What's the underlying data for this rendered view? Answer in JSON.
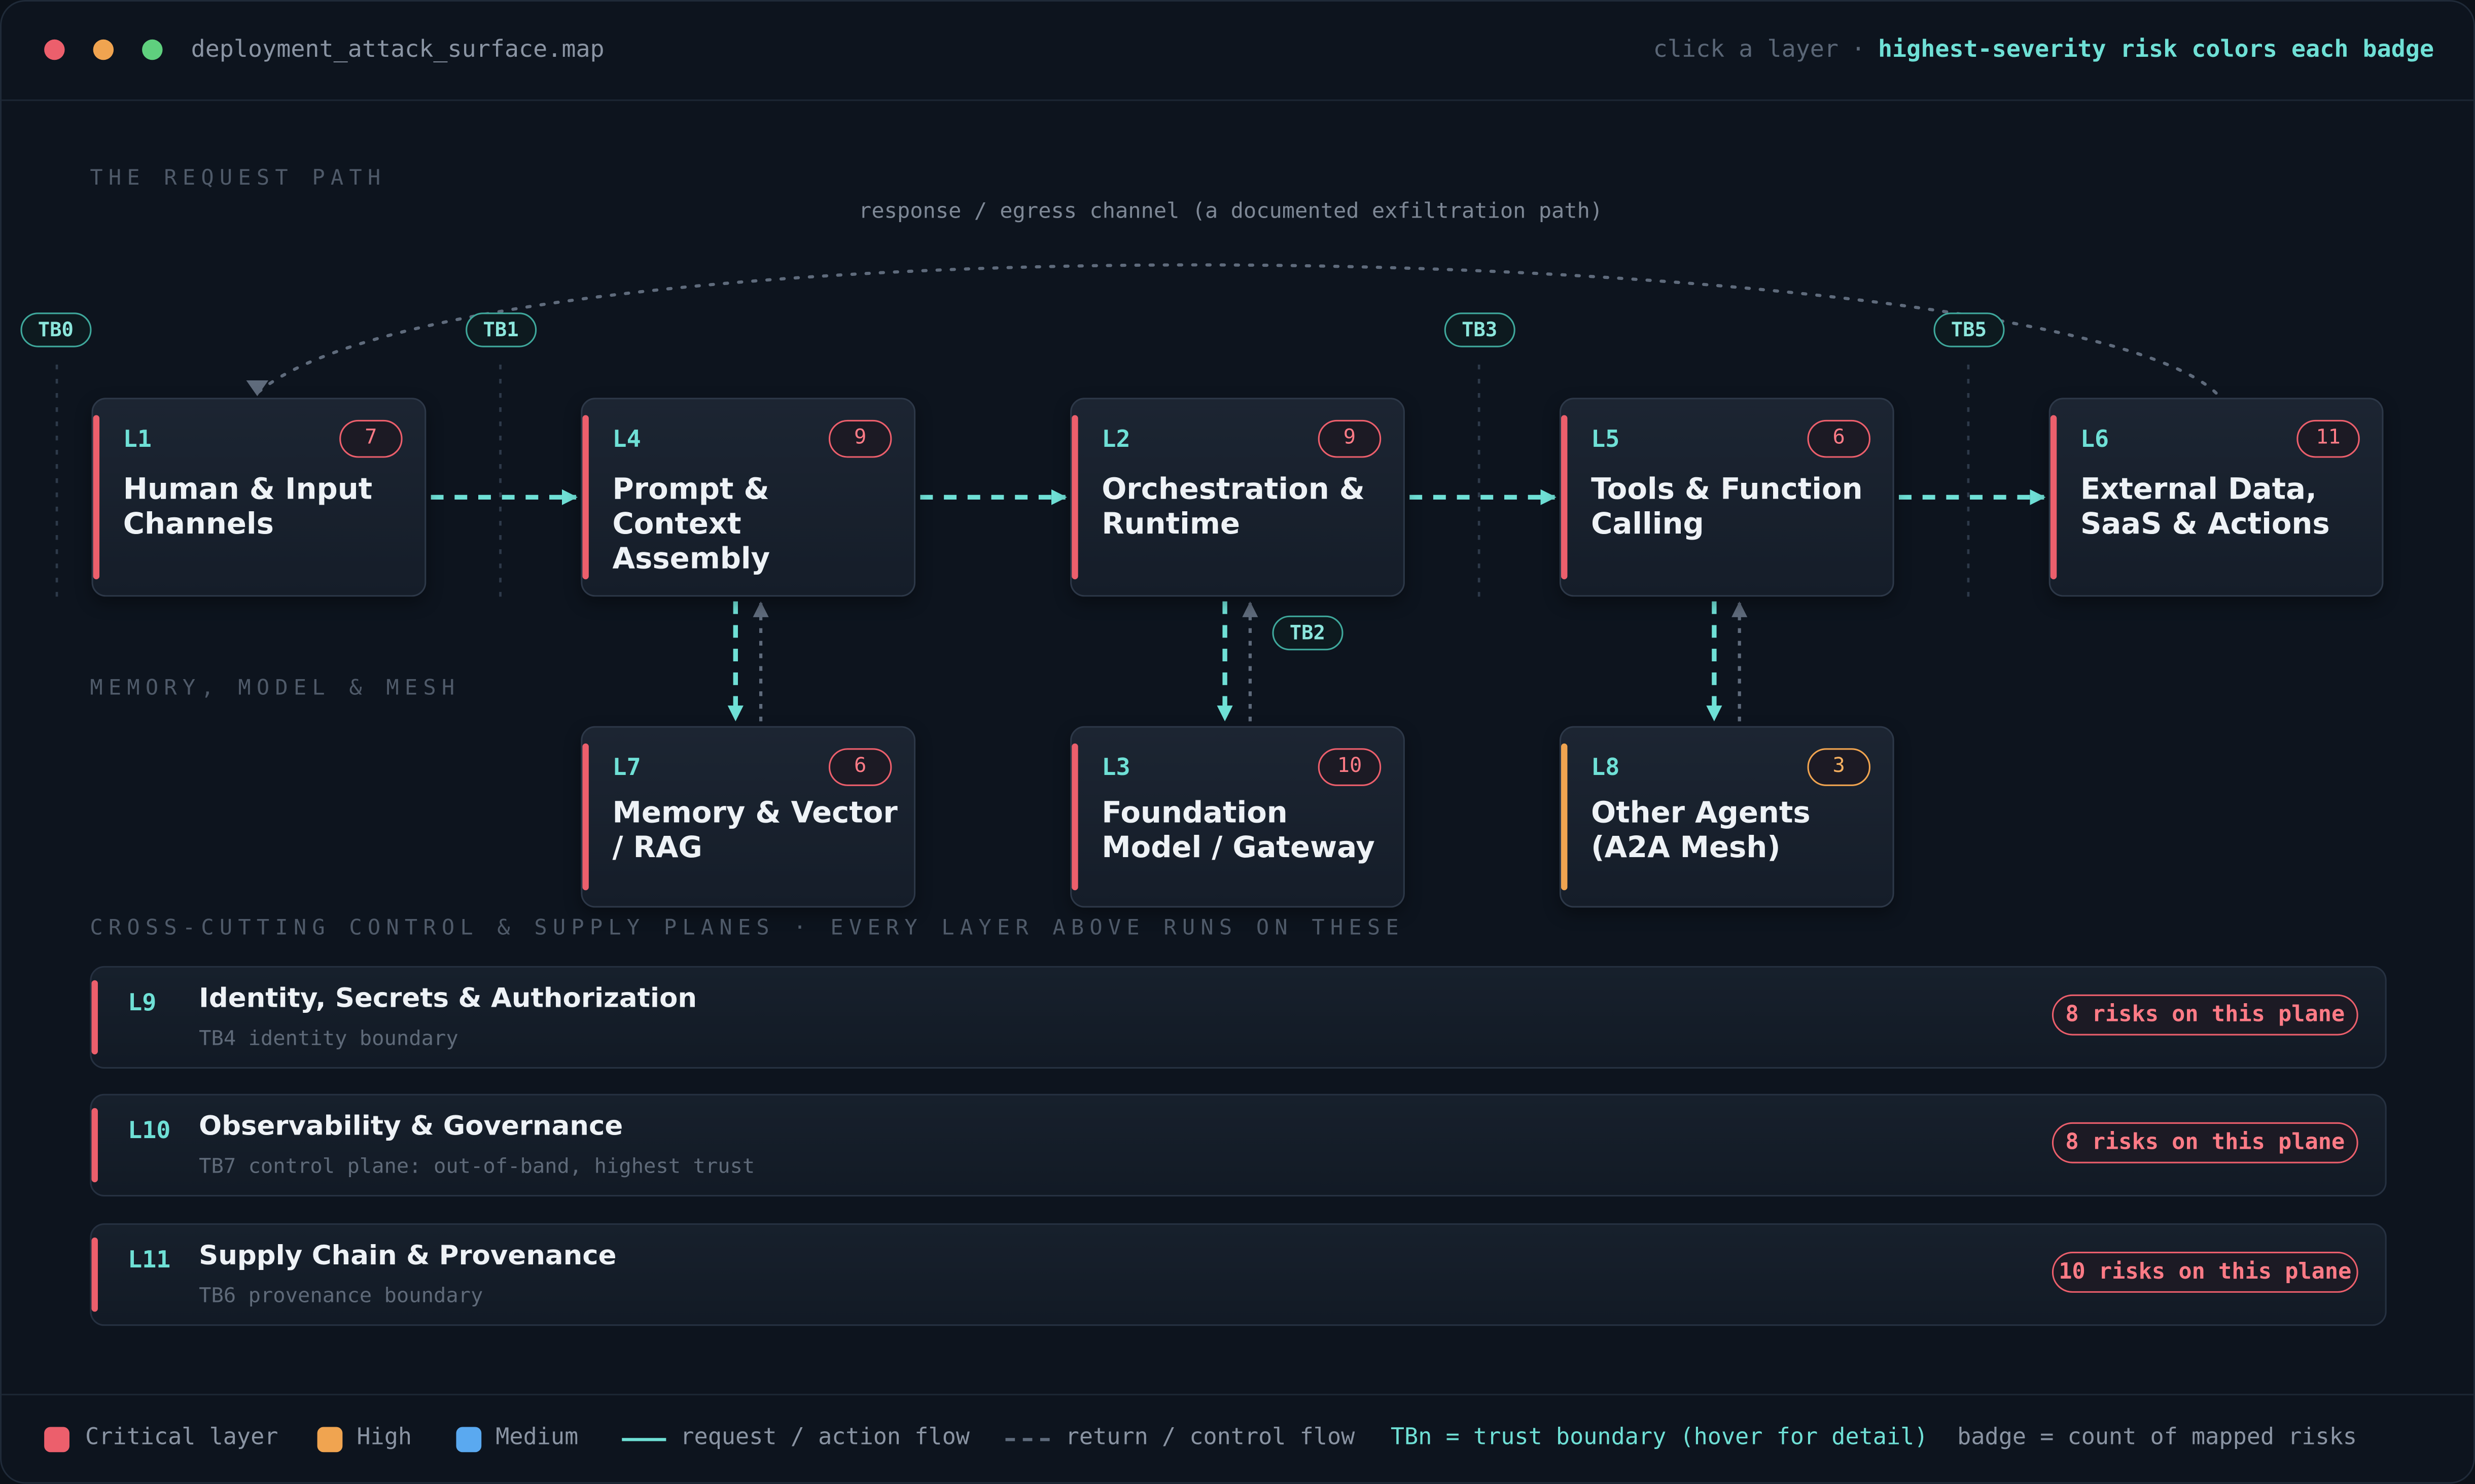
{
  "window": {
    "title": "deployment_attack_surface.map",
    "hint_muted": "click a layer",
    "hint_separator": "·",
    "hint_strong": "highest-severity risk colors each badge"
  },
  "sections": {
    "request_path": "THE REQUEST PATH",
    "memory": "MEMORY, MODEL & MESH",
    "planes": "CROSS-CUTTING CONTROL & SUPPLY PLANES · EVERY LAYER ABOVE RUNS ON THESE"
  },
  "egress_label": "response / egress channel (a documented exfiltration path)",
  "trust_boundaries": {
    "tb0": "TB0",
    "tb1": "TB1",
    "tb2": "TB2",
    "tb3": "TB3",
    "tb5": "TB5"
  },
  "layers": [
    {
      "id": "L1",
      "name": "Human & Input Channels",
      "risks": "7",
      "severity": "critical"
    },
    {
      "id": "L4",
      "name": "Prompt & Context Assembly",
      "risks": "9",
      "severity": "critical"
    },
    {
      "id": "L2",
      "name": "Orchestration & Runtime",
      "risks": "9",
      "severity": "critical"
    },
    {
      "id": "L5",
      "name": "Tools & Function Calling",
      "risks": "6",
      "severity": "critical"
    },
    {
      "id": "L6",
      "name": "External Data, SaaS & Actions",
      "risks": "11",
      "severity": "critical"
    },
    {
      "id": "L7",
      "name": "Memory & Vector / RAG",
      "risks": "6",
      "severity": "critical"
    },
    {
      "id": "L3",
      "name": "Foundation Model / Gateway",
      "risks": "10",
      "severity": "critical"
    },
    {
      "id": "L8",
      "name": "Other Agents (A2A Mesh)",
      "risks": "3",
      "severity": "high"
    }
  ],
  "planes": [
    {
      "id": "L9",
      "name": "Identity, Secrets & Authorization",
      "sub": "TB4 identity boundary",
      "badge": "8 risks on this plane",
      "severity": "critical"
    },
    {
      "id": "L10",
      "name": "Observability & Governance",
      "sub": "TB7 control plane: out-of-band, highest trust",
      "badge": "8 risks on this plane",
      "severity": "critical"
    },
    {
      "id": "L11",
      "name": "Supply Chain & Provenance",
      "sub": "TB6 provenance boundary",
      "badge": "10 risks on this plane",
      "severity": "critical"
    }
  ],
  "legend": {
    "critical": "Critical layer",
    "high": "High",
    "medium": "Medium",
    "request": "request / action flow",
    "return": "return / control flow",
    "tbn": "TBn = trust boundary (hover for detail)",
    "badge": "badge = count of mapped risks"
  },
  "colors": {
    "critical": "#ec5f6c",
    "high": "#f0a450",
    "medium": "#5aa9f0",
    "flow": "#6fe0d6",
    "return": "#5f6b7c"
  }
}
